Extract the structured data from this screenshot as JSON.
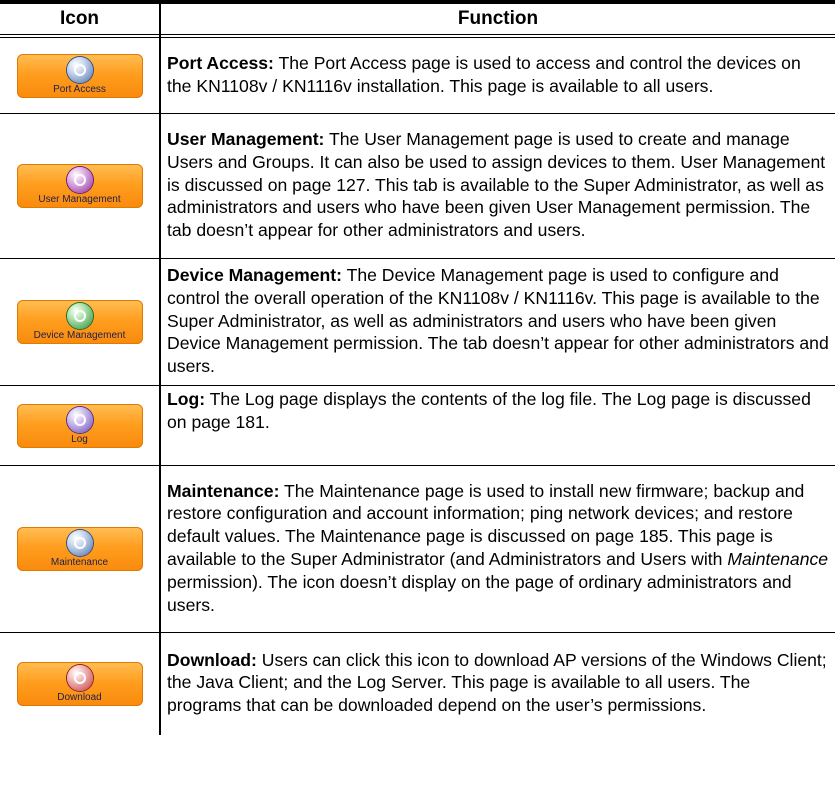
{
  "header": {
    "icon_col": "Icon",
    "function_col": "Function"
  },
  "rows": [
    {
      "icon_label": "Port Access",
      "term": "Port Access:",
      "description": " The Port Access page is used to access and control the devices on the KN1108v / KN1116v installation. This page is available to all users."
    },
    {
      "icon_label": "User Management",
      "term": "User Management:",
      "description": " The User Management page is used to create and manage Users and Groups. It can also be used to assign devices to them. User Management is discussed on page 127. This tab is available to the Super Administrator, as well as administrators and users who have been given User Management permission. The tab doesn’t appear for other administrators and users."
    },
    {
      "icon_label": "Device Management",
      "term": "Device Management:",
      "description": " The Device Management page is used to configure and control the overall operation of the KN1108v / KN1116v. This page is available to the Super Administrator, as well as administrators and users who have been given Device Management permission. The tab doesn’t appear for other administrators and users."
    },
    {
      "icon_label": "Log",
      "term": "Log:",
      "description": " The Log page displays the contents of the log file. The Log page is discussed on page 181."
    },
    {
      "icon_label": "Maintenance",
      "term": "Maintenance:",
      "description_before": " The Maintenance page is used to install new firmware; backup and restore configuration and account information; ping network devices; and restore default values. The Maintenance page is discussed on page 185. This page is available to the Super Administrator (and Administrators and Users with ",
      "description_italic": "Maintenance",
      "description_after": " permission). The icon doesn’t display on the page of ordinary administrators and users."
    },
    {
      "icon_label": "Download",
      "term": "Download:",
      "description": " Users can click this icon to download AP versions of the Windows Client; the Java Client; and the Log Server. This page is available to all users. The programs that can be downloaded depend on the user’s permissions."
    }
  ]
}
